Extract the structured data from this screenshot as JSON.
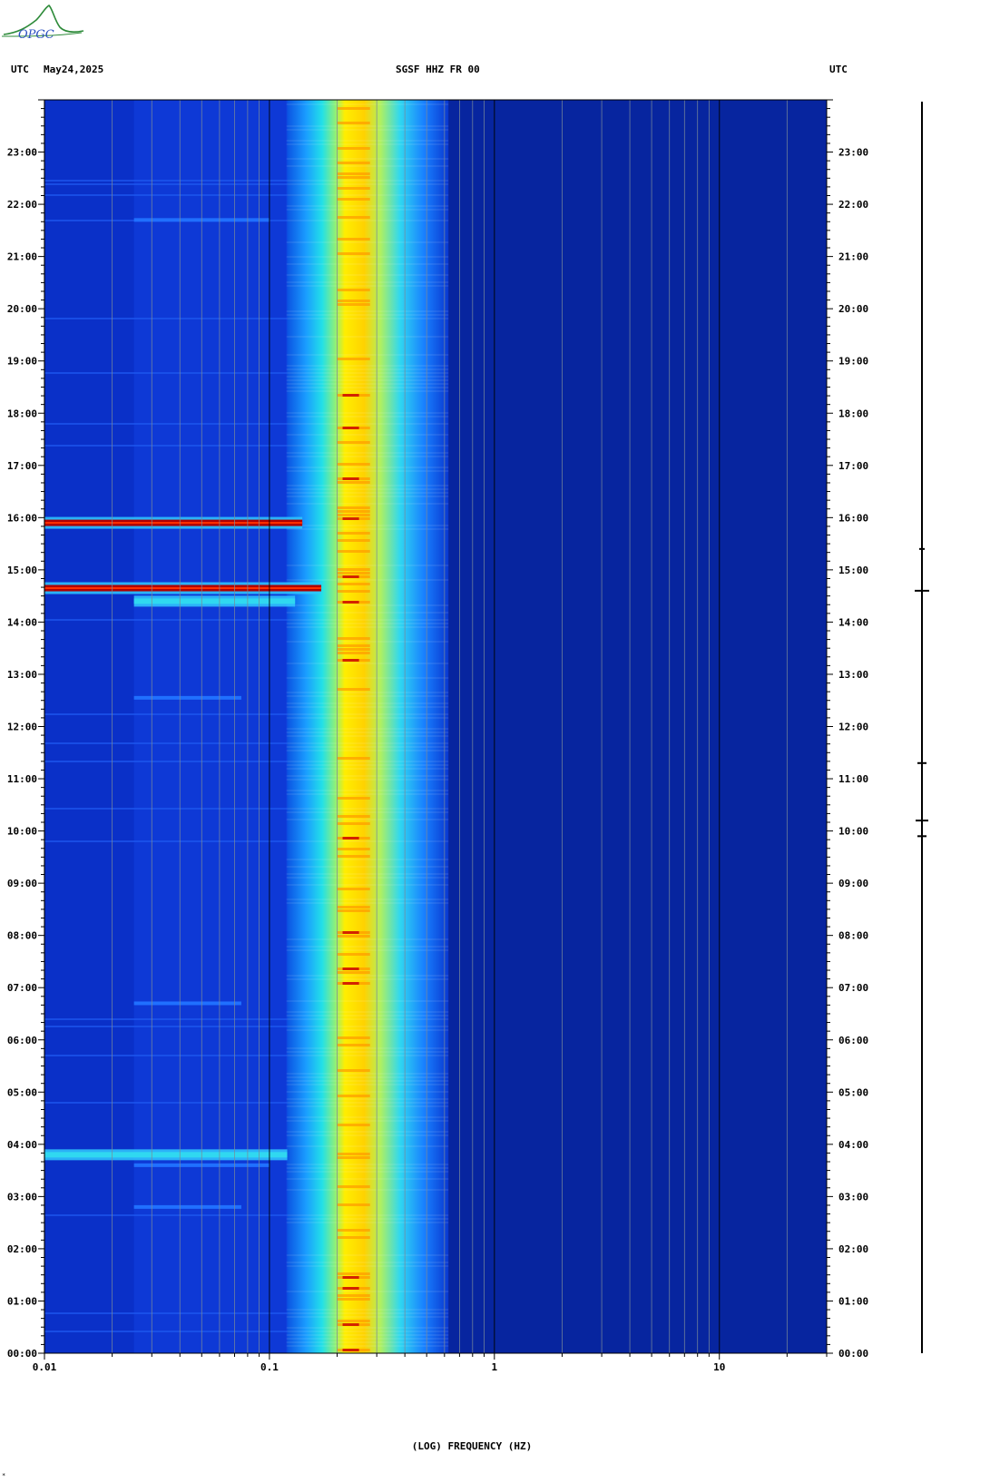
{
  "logo": {
    "text": "OPGC"
  },
  "header": {
    "left_tz": "UTC",
    "date": "May24,2025",
    "station": "SGSF HHZ FR 00",
    "right_tz": "UTC"
  },
  "colors": {
    "background": "#0a30c8",
    "high_freq_background": "#07259f",
    "microseism_core": "#ffe400",
    "peak": "#c80000",
    "grid_line": "#7a8a9a"
  },
  "chart_data": {
    "type": "heatmap",
    "title": "SGSF HHZ FR 00",
    "xlabel": "(LOG) FREQUENCY (HZ)",
    "ylabel": "",
    "x_scale": "log",
    "xlim": [
      0.01,
      30
    ],
    "x_ticks": [
      {
        "value": 0.01,
        "label": "0.01"
      },
      {
        "value": 0.1,
        "label": "0.1"
      },
      {
        "value": 1,
        "label": "1"
      },
      {
        "value": 10,
        "label": "10"
      }
    ],
    "ylim_hours": [
      0,
      24
    ],
    "y_ticks": [
      "00:00",
      "01:00",
      "02:00",
      "03:00",
      "04:00",
      "05:00",
      "06:00",
      "07:00",
      "08:00",
      "09:00",
      "10:00",
      "11:00",
      "12:00",
      "13:00",
      "14:00",
      "15:00",
      "16:00",
      "17:00",
      "18:00",
      "19:00",
      "20:00",
      "21:00",
      "22:00",
      "23:00"
    ],
    "grid": true,
    "colormap": "jet",
    "microseism_band_hz": [
      0.17,
      0.5
    ],
    "microseism_peak_hz": [
      0.2,
      0.28
    ],
    "events": [
      {
        "time_hours": 14.65,
        "fmin": 0.01,
        "fmax": 0.17,
        "intensity": "high"
      },
      {
        "time_hours": 15.9,
        "fmin": 0.01,
        "fmax": 0.14,
        "intensity": "high"
      },
      {
        "time_hours": 14.4,
        "fmin": 0.025,
        "fmax": 0.13,
        "intensity": "medium"
      },
      {
        "time_hours": 3.8,
        "fmin": 0.01,
        "fmax": 0.12,
        "intensity": "medium"
      },
      {
        "time_hours": 3.6,
        "fmin": 0.025,
        "fmax": 0.1,
        "intensity": "low"
      },
      {
        "time_hours": 2.8,
        "fmin": 0.025,
        "fmax": 0.075,
        "intensity": "low"
      },
      {
        "time_hours": 6.7,
        "fmin": 0.025,
        "fmax": 0.075,
        "intensity": "low"
      },
      {
        "time_hours": 12.55,
        "fmin": 0.025,
        "fmax": 0.075,
        "intensity": "low"
      },
      {
        "time_hours": 21.7,
        "fmin": 0.025,
        "fmax": 0.1,
        "intensity": "low"
      }
    ]
  }
}
